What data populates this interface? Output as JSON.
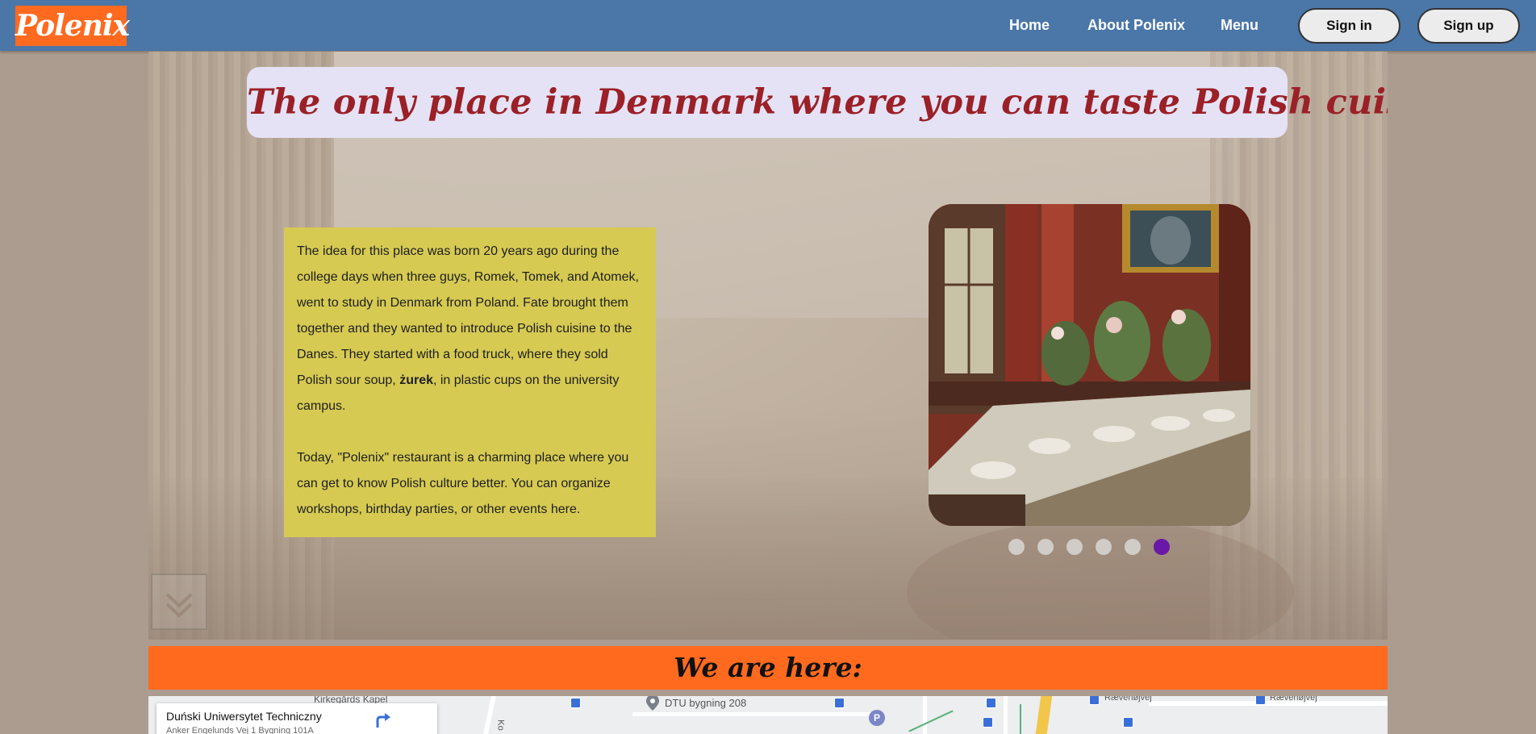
{
  "nav": {
    "logo": "Polenix",
    "links": [
      "Home",
      "About Polenix",
      "Menu"
    ],
    "sign_in": "Sign in",
    "sign_up": "Sign up"
  },
  "hero": {
    "headline": "The only place in Denmark where you can taste Polish cuisine",
    "story": {
      "p1_before": "The idea for this place was born 20 years ago during the college days when three guys, Romek, Tomek, and Atomek, went to study in Denmark from Poland. Fate brought them together and they wanted to introduce Polish cuisine to the Danes. They started with a food truck, where they sold Polish sour soup, ",
      "p1_bold": "żurek",
      "p1_after": ", in plastic cups on the university campus.",
      "p2": "Today, \"Polenix\" restaurant is a charming place where you can get to know Polish culture better. You can organize workshops, birthday parties, or other events here."
    },
    "carousel": {
      "slide_count": 6,
      "active_index": 5
    }
  },
  "location": {
    "title": "We are here:"
  },
  "map": {
    "card_title": "Duński Uniwersytet Techniczny",
    "card_address": "Anker Engelunds Vej 1 Bygning 101A",
    "labels": {
      "chapel": "Kirkegårds Kapel",
      "building": "DTU bygning 208",
      "road1": "Rævehøjvej",
      "road2": "Rævehøjvej",
      "side": "Ko"
    },
    "parking": "P",
    "colors": {
      "map_bg": "#eceeef",
      "transit": "#3b6fd8"
    }
  },
  "colors": {
    "navbar": "#4a76a8",
    "logo_bg": "#ff6a1f",
    "headline": "#9b2027",
    "story_bg": "#d6ca53",
    "accent_orange": "#ff6a1f",
    "dot_active": "#6a18a8",
    "page_bg": "#ac9c8f"
  }
}
